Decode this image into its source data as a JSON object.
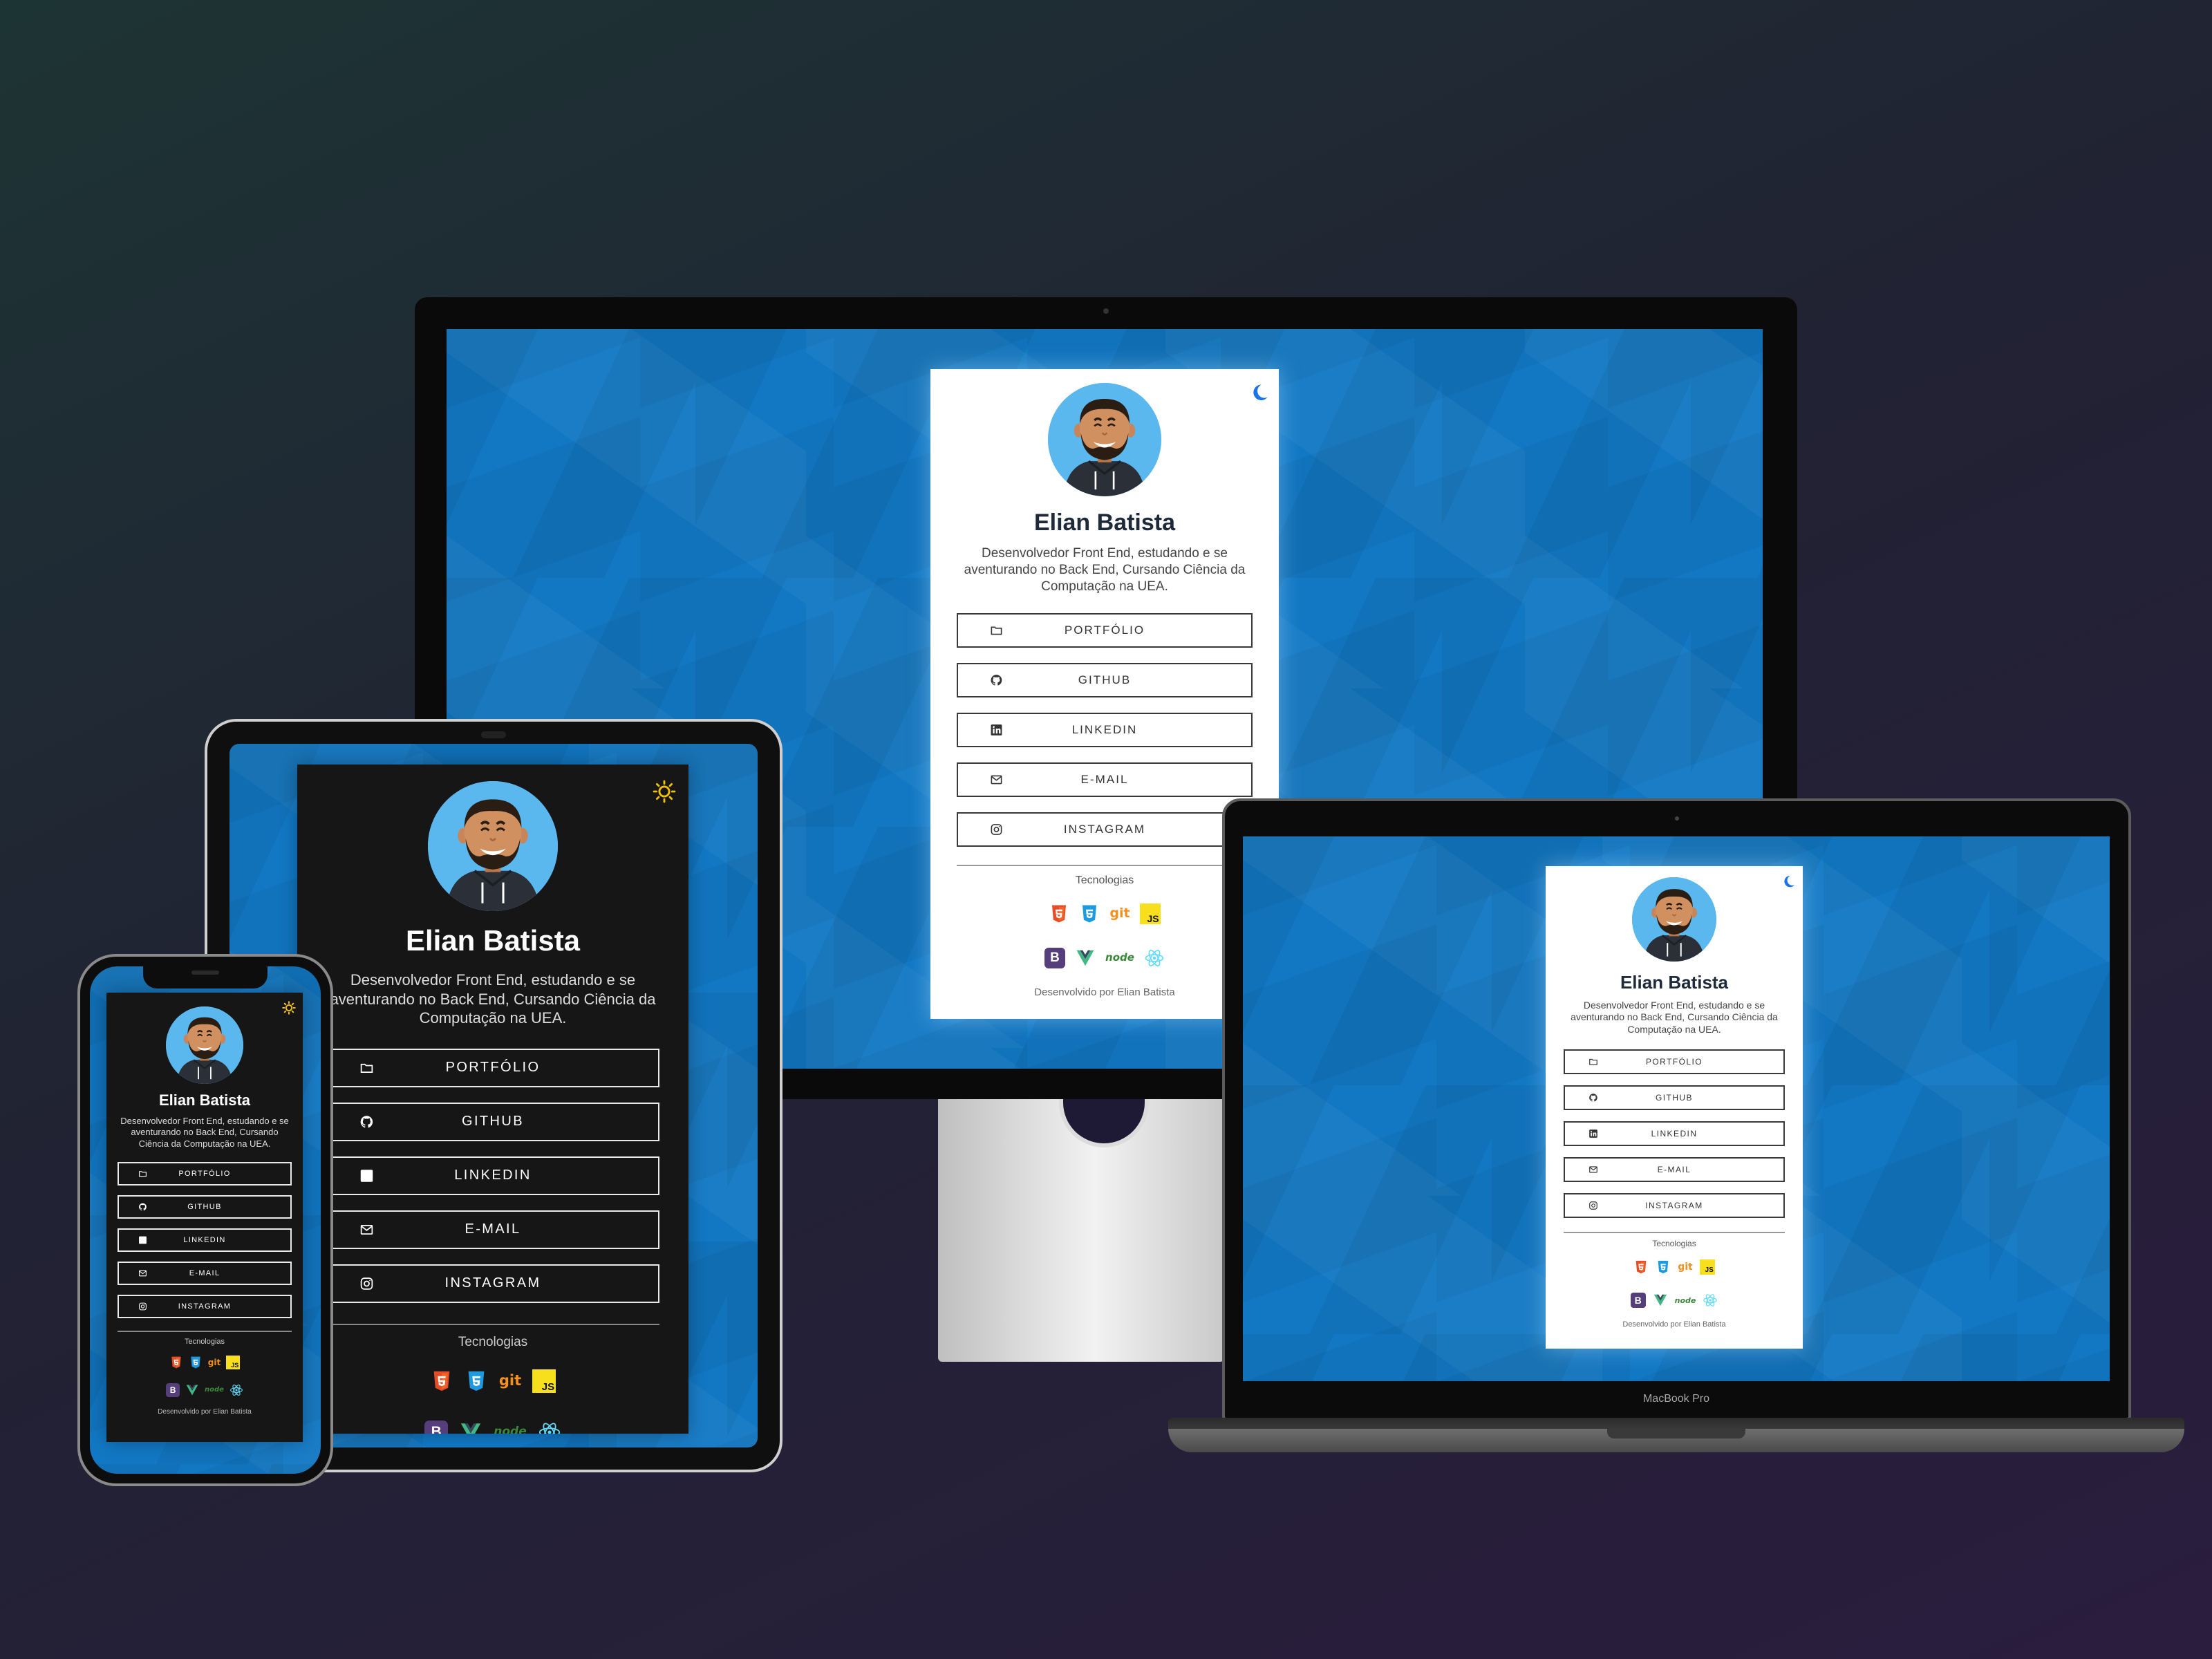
{
  "profile": {
    "name": "Elian Batista",
    "bio": "Desenvolvedor Front End, estudando e se aventurando no Back End, Cursando Ciência da Computação na UEA.",
    "buttons": [
      {
        "label": "PORTFÓLIO",
        "icon": "folder-icon"
      },
      {
        "label": "GITHUB",
        "icon": "github-icon"
      },
      {
        "label": "LINKEDIN",
        "icon": "linkedin-icon"
      },
      {
        "label": "E-MAIL",
        "icon": "email-icon"
      },
      {
        "label": "INSTAGRAM",
        "icon": "instagram-icon"
      }
    ],
    "technologies_title": "Tecnologias",
    "technologies_row1": [
      {
        "name": "html5",
        "icon": "html5-icon",
        "color": "#e44d26"
      },
      {
        "name": "css3",
        "icon": "css3-icon",
        "color": "#1d9ae0"
      },
      {
        "name": "git",
        "icon": "git-icon",
        "color": "#f4901e"
      },
      {
        "name": "javascript",
        "icon": "javascript-icon",
        "color": "#f7df1e"
      }
    ],
    "technologies_row2": [
      {
        "name": "bootstrap",
        "icon": "bootstrap-icon",
        "color": "#563d7c"
      },
      {
        "name": "vue",
        "icon": "vue-icon",
        "color": "#41b883"
      },
      {
        "name": "node",
        "icon": "node-icon",
        "color": "#3c873a"
      },
      {
        "name": "react",
        "icon": "react-icon",
        "color": "#61dafb"
      }
    ],
    "credit": "Desenvolvido por Elian Batista"
  },
  "tech_glyphs": {
    "git": "git",
    "js": "JS",
    "bootstrap": "B",
    "node": "node"
  },
  "devices": {
    "laptop_label": "MacBook Pro"
  },
  "theme": {
    "light_toggle_icon": "moon-icon",
    "dark_toggle_icon": "sun-icon",
    "wallpaper_color": "#1278c4",
    "moon_color": "#1a73e8",
    "sun_color": "#f2c200"
  }
}
